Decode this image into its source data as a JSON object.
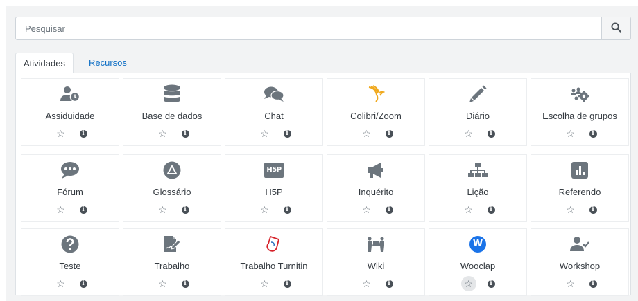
{
  "search": {
    "placeholder": "Pesquisar",
    "button_icon": "search-icon"
  },
  "tabs": [
    {
      "label": "Atividades",
      "active": true
    },
    {
      "label": "Recursos",
      "active": false
    }
  ],
  "colors": {
    "icon": "#6c757d",
    "link": "#0f6fc5",
    "colibri": "#f0a91e",
    "turnitin": "#d6222a",
    "wooclap": "#1a73e8"
  },
  "activities": [
    {
      "label": "Assiduidade",
      "icon": "attendance-icon"
    },
    {
      "label": "Base de dados",
      "icon": "database-icon"
    },
    {
      "label": "Chat",
      "icon": "chat-icon"
    },
    {
      "label": "Colibri/Zoom",
      "icon": "colibri-icon"
    },
    {
      "label": "Diário",
      "icon": "pencil-icon"
    },
    {
      "label": "Escolha de grupos",
      "icon": "group-choice-icon"
    },
    {
      "label": "Fórum",
      "icon": "forum-icon"
    },
    {
      "label": "Glossário",
      "icon": "glossary-icon"
    },
    {
      "label": "H5P",
      "icon": "h5p-icon",
      "icon_text": "H5P"
    },
    {
      "label": "Inquérito",
      "icon": "megaphone-icon"
    },
    {
      "label": "Lição",
      "icon": "sitemap-icon"
    },
    {
      "label": "Referendo",
      "icon": "poll-icon"
    },
    {
      "label": "Teste",
      "icon": "question-icon"
    },
    {
      "label": "Trabalho",
      "icon": "assignment-icon"
    },
    {
      "label": "Trabalho Turnitin",
      "icon": "turnitin-icon"
    },
    {
      "label": "Wiki",
      "icon": "wiki-icon"
    },
    {
      "label": "Wooclap",
      "icon": "wooclap-icon",
      "icon_text": "W"
    },
    {
      "label": "Workshop",
      "icon": "workshop-icon"
    }
  ],
  "actions": {
    "star_glyph": "☆",
    "info_glyph": "i"
  }
}
